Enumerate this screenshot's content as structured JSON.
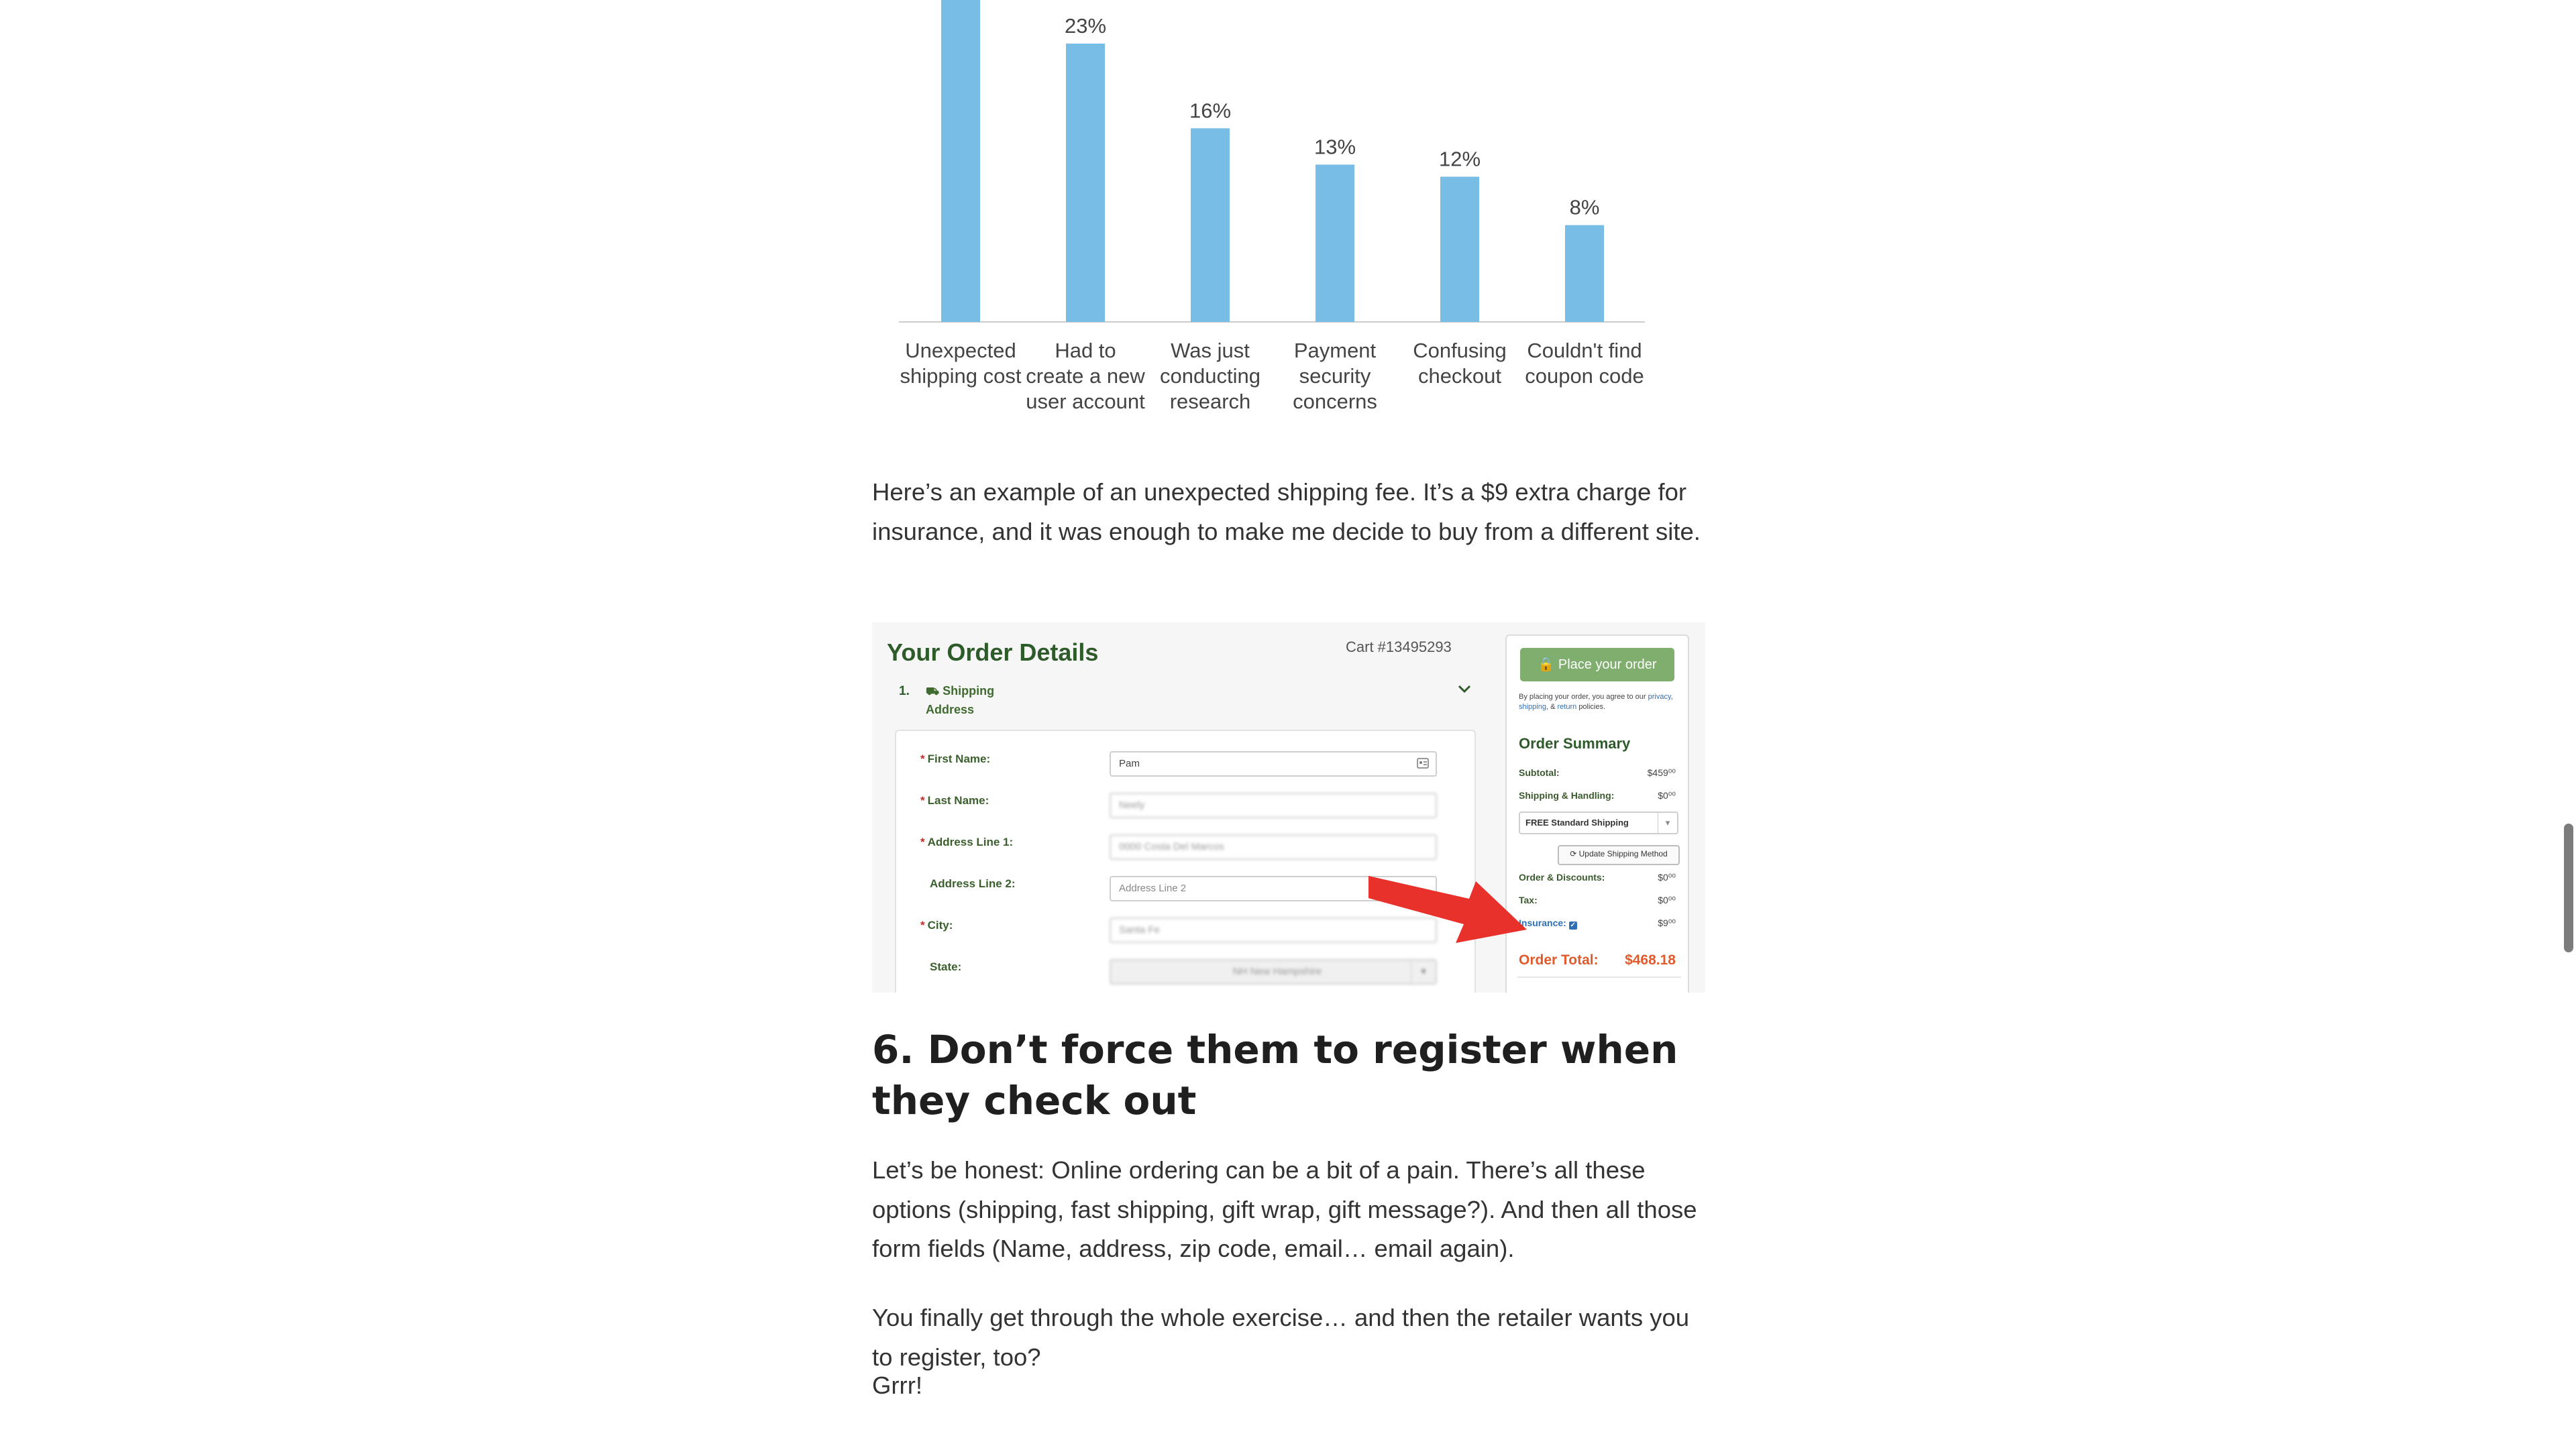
{
  "chart_data": {
    "type": "bar",
    "categories": [
      [
        "Unexpected",
        "shipping cost"
      ],
      [
        "Had to",
        "create a new",
        "user account"
      ],
      [
        "Was just",
        "conducting",
        "research"
      ],
      [
        "Payment",
        "security",
        "concerns"
      ],
      [
        "Confusing",
        "checkout"
      ],
      [
        "Couldn't find",
        "coupon code"
      ]
    ],
    "values": [
      28,
      23,
      16,
      13,
      12,
      8
    ],
    "value_labels": [
      "",
      "23%",
      "16%",
      "13%",
      "12%",
      "8%"
    ],
    "bar_color": "#78bde6",
    "axis_color": "#cccccc",
    "label_color": "#444444",
    "ylim": [
      0,
      30
    ],
    "grid": false
  },
  "paragraph1": "Here’s an example of an unexpected shipping fee. It’s a $9 extra charge for insurance, and it was enough to make me decide to buy from a different site.",
  "order_screenshot": {
    "title": "Your Order Details",
    "cart_number": "Cart #13495293",
    "step_number": "1.",
    "step_label_line1": "Shipping",
    "step_label_line2": "Address",
    "truck_icon": "⛟",
    "fields": [
      {
        "label": "First Name:",
        "required": true,
        "value": "Pam",
        "type": "text"
      },
      {
        "label": "Last Name:",
        "required": true,
        "value": "Neely",
        "type": "blurred"
      },
      {
        "label": "Address Line 1:",
        "required": true,
        "value": "0000 Costa Del Marcos",
        "type": "blurred"
      },
      {
        "label": "Address Line 2:",
        "required": false,
        "value": "Address Line 2",
        "type": "placeholder"
      },
      {
        "label": "City:",
        "required": true,
        "value": "Santa Fe",
        "type": "blurred"
      },
      {
        "label": "State:",
        "required": false,
        "value": "NH  New Hampshire",
        "type": "select"
      }
    ],
    "place_order_label": "🔒 Place your order",
    "policy_prefix": "By placing your order, you agree to our",
    "policy_links": [
      "privacy",
      "shipping",
      "return"
    ],
    "policy_suffix": "policies.",
    "summary_title": "Order Summary",
    "subtotal_label": "Subtotal:",
    "subtotal_value": "$459⁰⁰",
    "shipping_label": "Shipping & Handling:",
    "shipping_value": "$0⁰⁰",
    "shipping_option": "FREE Standard Shipping",
    "update_button": "⟳ Update Shipping Method",
    "discounts_label": "Order & Discounts:",
    "discounts_value": "$0⁰⁰",
    "tax_label": "Tax:",
    "tax_value": "$0⁰⁰",
    "insurance_label": "Insurance:",
    "insurance_value": "$9⁰⁰",
    "total_label": "Order Total:",
    "total_value": "$468.18",
    "arrow_color": "#e8312a"
  },
  "section_heading": "6. Don’t force them to register when they check out",
  "paragraph2": "Let’s be honest: Online ordering can be a bit of a pain. There’s all these options (shipping, fast shipping, gift wrap, gift message?). And then all those form fields (Name, address, zip code, email… email again).",
  "paragraph3": "You finally get through the whole exercise… and then the retailer wants you to register, too?",
  "paragraph4": "Grrr!"
}
